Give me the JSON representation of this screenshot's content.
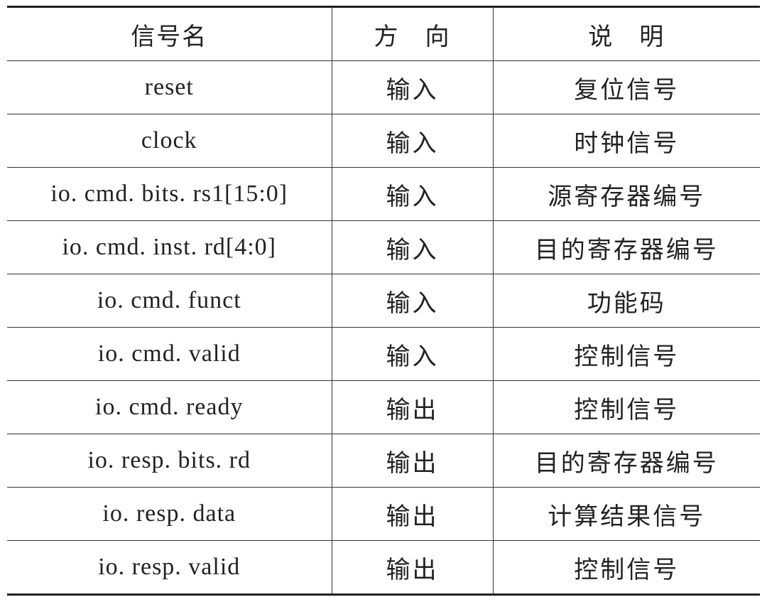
{
  "table": {
    "headers": [
      "信号名",
      "方　向",
      "说　明"
    ],
    "rows": [
      {
        "signal": "reset",
        "direction": "输入",
        "description": "复位信号"
      },
      {
        "signal": "clock",
        "direction": "输入",
        "description": "时钟信号"
      },
      {
        "signal": "io. cmd. bits. rs1[15:0]",
        "direction": "输入",
        "description": "源寄存器编号"
      },
      {
        "signal": "io. cmd. inst. rd[4:0]",
        "direction": "输入",
        "description": "目的寄存器编号"
      },
      {
        "signal": "io. cmd. funct",
        "direction": "输入",
        "description": "功能码"
      },
      {
        "signal": "io. cmd. valid",
        "direction": "输入",
        "description": "控制信号"
      },
      {
        "signal": "io. cmd. ready",
        "direction": "输出",
        "description": "控制信号"
      },
      {
        "signal": "io. resp. bits. rd",
        "direction": "输出",
        "description": "目的寄存器编号"
      },
      {
        "signal": "io. resp. data",
        "direction": "输出",
        "description": "计算结果信号"
      },
      {
        "signal": "io. resp. valid",
        "direction": "输出",
        "description": "控制信号"
      }
    ]
  }
}
